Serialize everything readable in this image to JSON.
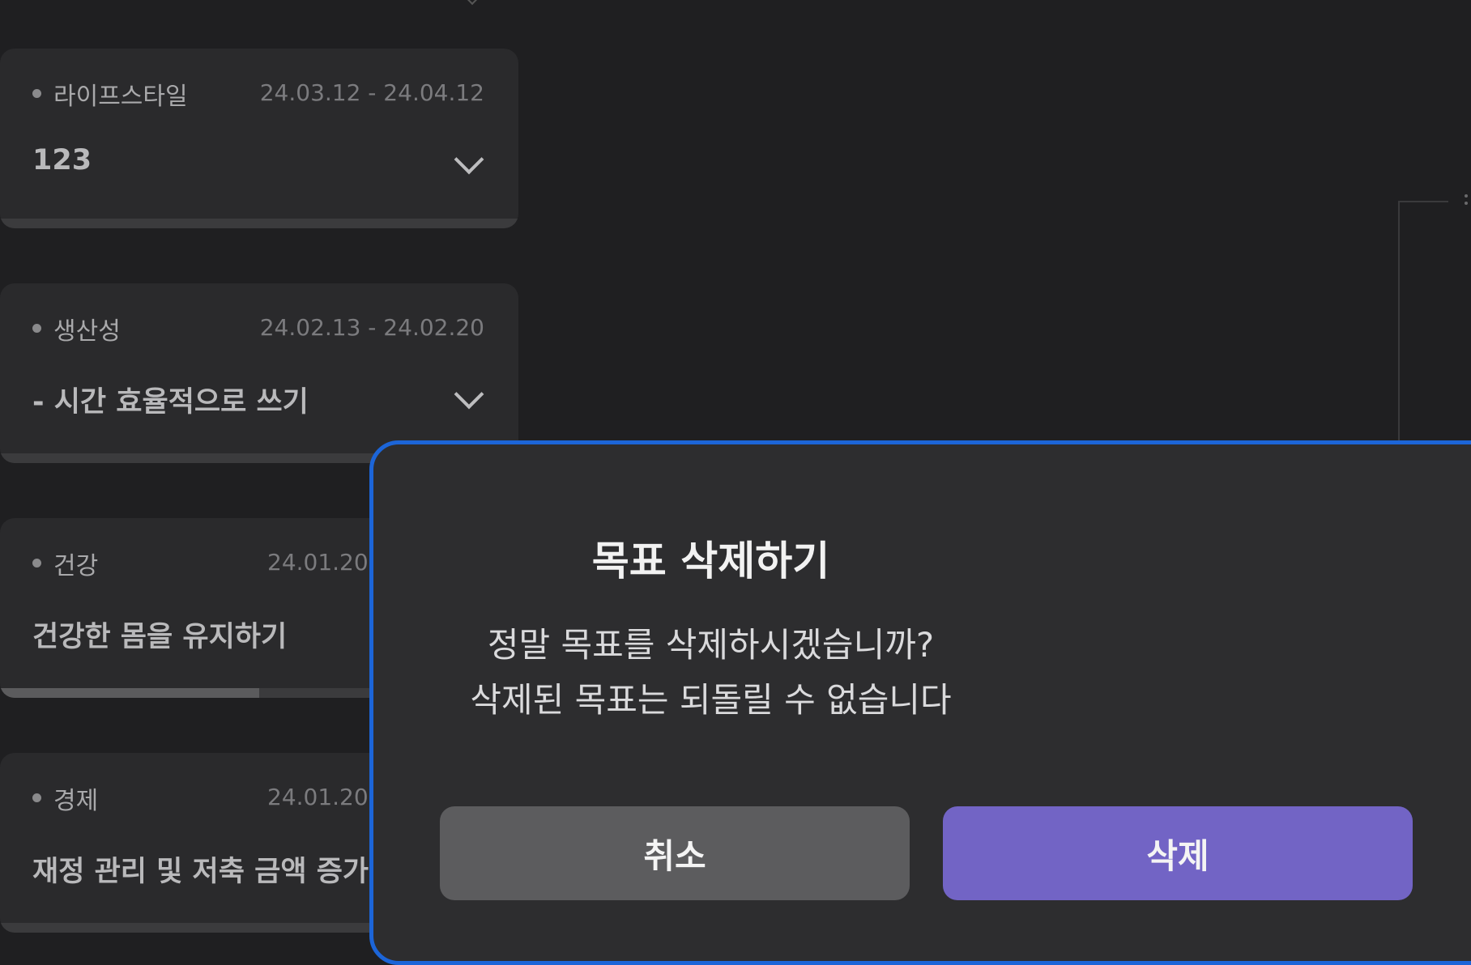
{
  "goals": [
    {
      "category": "라이프스타일",
      "dates": "24.03.12 - 24.04.12",
      "title": "123",
      "progress": 0
    },
    {
      "category": "생산성",
      "dates": "24.02.13 - 24.02.20",
      "title": "- 시간 효율적으로 쓰기",
      "progress": 0
    },
    {
      "category": "건강",
      "dates": "24.01.20",
      "title": "건강한 몸을 유지하기",
      "progress": 0.5
    },
    {
      "category": "경제",
      "dates": "24.01.20",
      "title": "재정 관리 및 저축 금액 증가",
      "progress": 0
    }
  ],
  "modal": {
    "title": "목표 삭제하기",
    "message_line1": "정말 목표를 삭제하시겠습니까?",
    "message_line2": "삭제된 목표는 되돌릴 수 없습니다",
    "cancel_label": "취소",
    "delete_label": "삭제"
  },
  "colors": {
    "background": "#1f1f21",
    "card": "#2a2a2c",
    "modal_border": "#1c65d8",
    "delete_button": "#7264c5",
    "cancel_button": "#5c5c5e"
  },
  "icons": {
    "expand": "chevron-down-icon",
    "category_marker": "dot-icon"
  }
}
